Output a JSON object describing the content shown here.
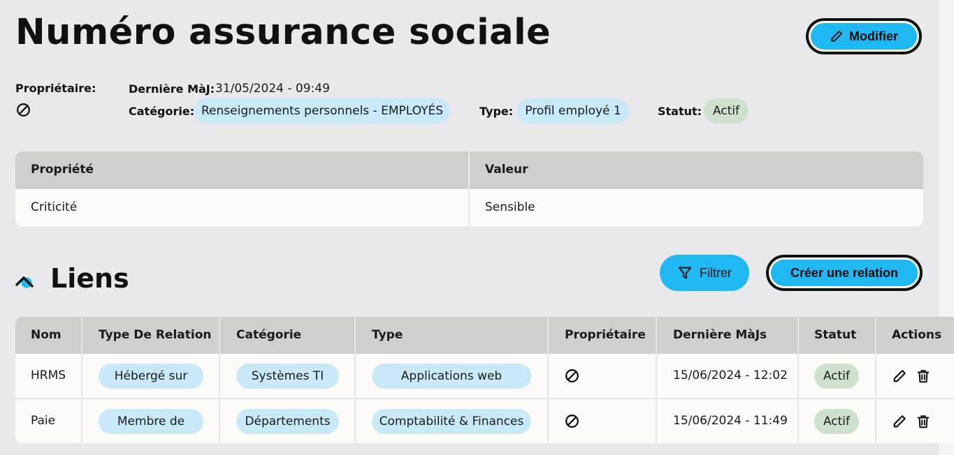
{
  "header": {
    "title": "Numéro assurance sociale",
    "edit_button_label": "Modifier"
  },
  "meta": {
    "owner_label": "Propriétaire:",
    "last_update_label": "Dernière MàJ:",
    "last_update_value": "31/05/2024 - 09:49",
    "category_label": "Catégorie:",
    "category_value": "Renseignements personnels - EMPLOYÉS",
    "type_label": "Type:",
    "type_value": "Profil employé 1",
    "status_label": "Statut:",
    "status_value": "Actif"
  },
  "properties": {
    "headers": [
      "Propriété",
      "Valeur"
    ],
    "rows": [
      {
        "property": "Criticité",
        "value": "Sensible"
      }
    ]
  },
  "links": {
    "title": "Liens",
    "filter_label": "Filtrer",
    "create_label": "Créer une relation",
    "headers": [
      "Nom",
      "Type De Relation",
      "Catégorie",
      "Type",
      "Propriétaire",
      "Dernière MàJs",
      "Statut",
      "Actions"
    ],
    "rows": [
      {
        "name": "HRMS",
        "relation": "Hébergé sur",
        "category": "Systèmes TI",
        "type": "Applications web",
        "updated": "15/06/2024 - 12:02",
        "status": "Actif"
      },
      {
        "name": "Paie",
        "relation": "Membre de",
        "category": "Départements",
        "type": "Comptabilité & Finances",
        "updated": "15/06/2024 - 11:49",
        "status": "Actif"
      }
    ]
  },
  "colors": {
    "accent": "#1fb8f3",
    "pill_blue": "#c9e9f8",
    "pill_green": "#cde2cd",
    "table_header": "#d0cfcb",
    "background": "#e9e8ea"
  },
  "icons": {
    "edit": "pencil-icon",
    "owner_none": "no-entry-icon",
    "filter": "filter-icon",
    "collapse": "chevron-up-icon",
    "delete": "trash-icon"
  }
}
